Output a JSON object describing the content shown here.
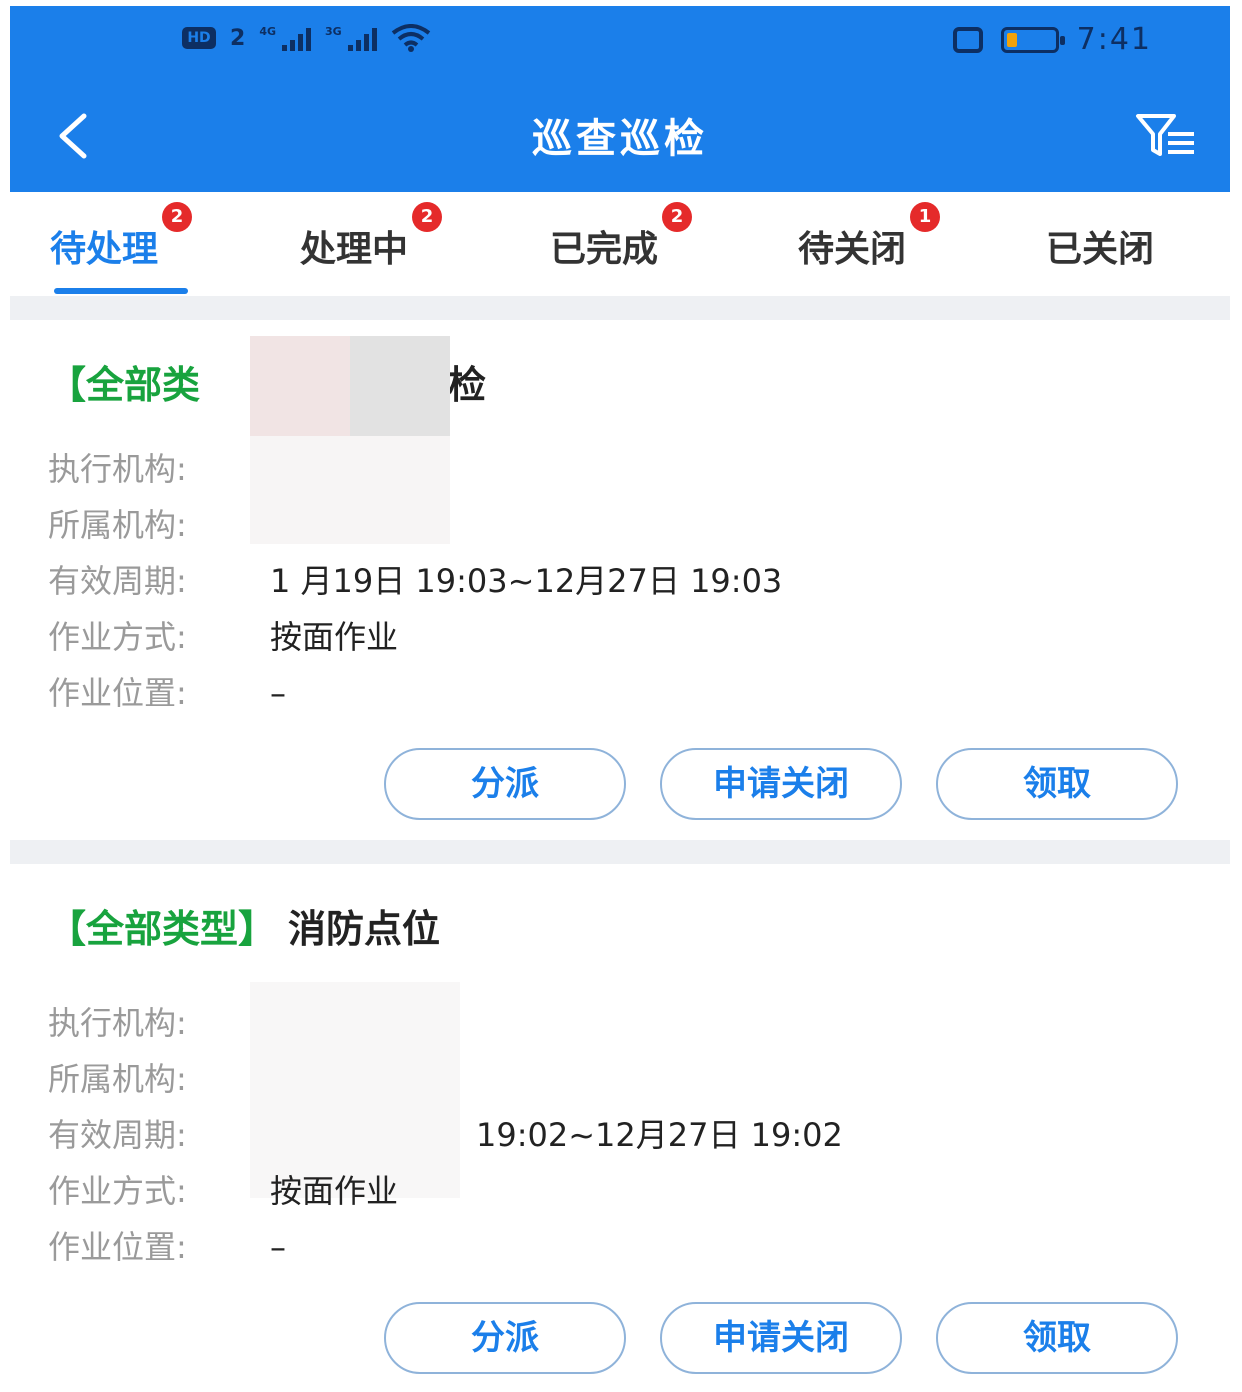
{
  "status_bar": {
    "left_badges": [
      "HD",
      "2"
    ],
    "signal_1": "4G",
    "signal_2": "3G",
    "time": "7:41"
  },
  "header": {
    "title": "巡查巡检",
    "back_icon": "chevron-left-icon",
    "filter_icon": "filter-list-icon"
  },
  "tabs": [
    {
      "label": "待处理",
      "badge": "2",
      "active": true
    },
    {
      "label": "处理中",
      "badge": "2"
    },
    {
      "label": "已完成",
      "badge": "2"
    },
    {
      "label": "待关闭",
      "badge": "1"
    },
    {
      "label": "已关闭",
      "badge": ""
    }
  ],
  "cards": [
    {
      "category": "【全部类",
      "name": "巡检",
      "fields": [
        {
          "label": "执行机构:",
          "value": ""
        },
        {
          "label": "所属机构:",
          "value": ""
        },
        {
          "label": "有效周期:",
          "value": "1 月19日 19:03~12月27日 19:03"
        },
        {
          "label": "作业方式:",
          "value": "按面作业"
        },
        {
          "label": "作业位置:",
          "value": "–"
        }
      ],
      "buttons": [
        "分派",
        "申请关闭",
        "领取"
      ]
    },
    {
      "category": "【全部类型】",
      "name": "消防点位",
      "fields": [
        {
          "label": "执行机构:",
          "value": ""
        },
        {
          "label": "所属机构:",
          "value": ""
        },
        {
          "label": "有效周期:",
          "value": "19:02~12月27日 19:02"
        },
        {
          "label": "作业方式:",
          "value": "按面作业"
        },
        {
          "label": "作业位置:",
          "value": "–"
        }
      ],
      "buttons": [
        "分派",
        "申请关闭",
        "领取"
      ]
    }
  ],
  "colors": {
    "header_bg": "#1b7fea",
    "accent": "#1b7fea",
    "category_green": "#18a33e",
    "badge_red": "#e52a2a",
    "label_gray": "#9a9a9a"
  }
}
